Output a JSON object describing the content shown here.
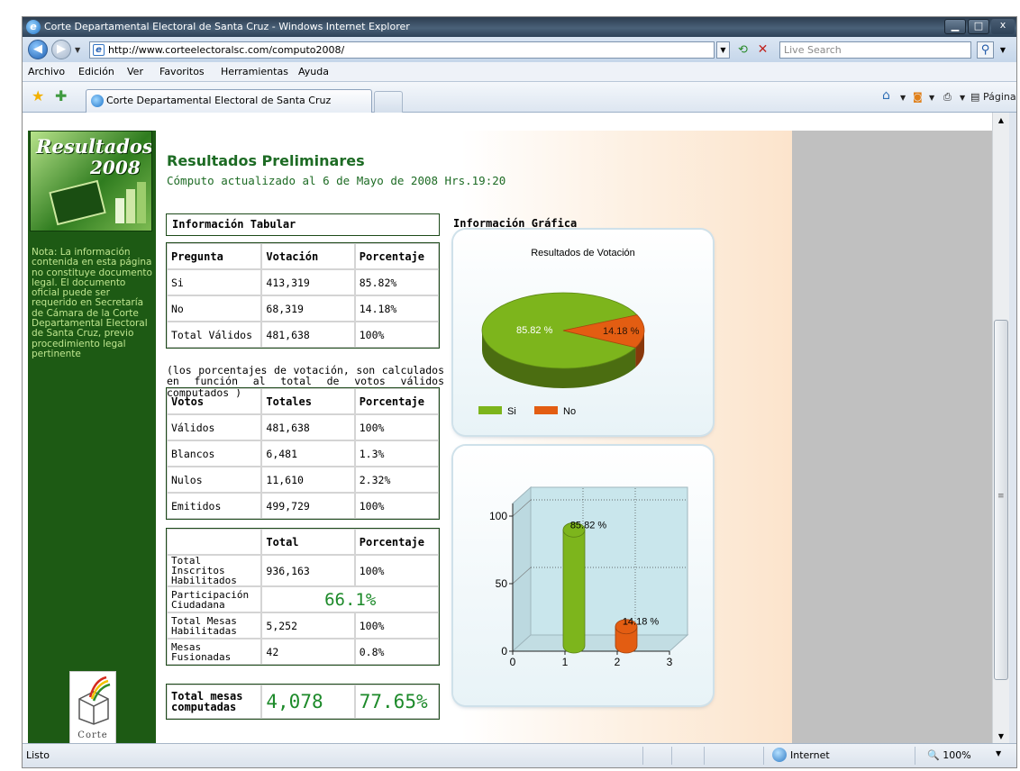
{
  "window": {
    "title": "Corte Departamental Electoral de Santa Cruz - Windows Internet Explorer",
    "close_glyph": "x"
  },
  "address": {
    "url": "http://www.corteelectoralsc.com/computo2008/",
    "search_placeholder": "Live Search"
  },
  "menu": [
    "Archivo",
    "Edición",
    "Ver",
    "Favoritos",
    "Herramientas",
    "Ayuda"
  ],
  "tab": {
    "label": "Corte Departamental Electoral de Santa Cruz"
  },
  "commands": {
    "page": "Página",
    "tools": "Herramientas"
  },
  "sidebar": {
    "logo_word": "Resultados",
    "logo_year": "2008",
    "note": "Nota: La información contenida en esta página no constituye documento legal. El documento oficial puede ser requerido en Secretaría de Cámara de la Corte Departamental Electoral de Santa Cruz, previo procedimiento legal pertinente",
    "footer_logo": "Corte"
  },
  "main": {
    "title": "Resultados Preliminares",
    "subtitle": "Cómputo actualizado al 6 de Mayo de 2008 Hrs.19:20",
    "tabular_heading": "Información Tabular",
    "graphic_heading": "Información Gráfica",
    "note": "(los porcentajes de votación, son calculados en función al total de votos válidos computados )",
    "table_votacion": {
      "headers": [
        "Pregunta",
        "Votación",
        "Porcentaje"
      ],
      "rows": [
        [
          "Si",
          "413,319",
          "85.82%"
        ],
        [
          "No",
          "68,319",
          "14.18%"
        ],
        [
          "Total Válidos",
          "481,638",
          "100%"
        ]
      ]
    },
    "table_votos": {
      "headers": [
        "Votos",
        "Totales",
        "Porcentaje"
      ],
      "rows": [
        [
          "Válidos",
          "481,638",
          "100%"
        ],
        [
          "Blancos",
          "6,481",
          "1.3%"
        ],
        [
          "Nulos",
          "11,610",
          "2.32%"
        ],
        [
          "Emitidos",
          "499,729",
          "100%"
        ]
      ]
    },
    "table_inscritos": {
      "headers": [
        "",
        "Total",
        "Porcentaje"
      ],
      "rows": [
        [
          "Total Inscritos Habilitados",
          "936,163",
          "100%"
        ],
        [
          "Participación Ciudadana",
          "66.1%"
        ],
        [
          "Total Mesas Habilitadas",
          "5,252",
          "100%"
        ],
        [
          "Mesas Fusionadas",
          "42",
          "0.8%"
        ]
      ]
    },
    "table_total": {
      "label": "Total mesas computadas",
      "value": "4,078",
      "percent": "77.65%"
    }
  },
  "chart_data": [
    {
      "type": "pie",
      "title": "Resultados de Votación",
      "categories": [
        "Si",
        "No"
      ],
      "values": [
        85.82,
        14.18
      ],
      "labels": [
        "85.82 %",
        "14.18 %"
      ],
      "colors": [
        "#7db51c",
        "#e35d12"
      ],
      "legend": "bottom-left"
    },
    {
      "type": "bar",
      "x": [
        1,
        2
      ],
      "values": [
        85.82,
        14.18
      ],
      "labels": [
        "85.82 %",
        "14.18 %"
      ],
      "colors": [
        "#7db51c",
        "#e35d12"
      ],
      "xlim": [
        0,
        3
      ],
      "ylim": [
        0,
        100
      ],
      "xticks": [
        "0",
        "1",
        "2",
        "3"
      ],
      "yticks": [
        "0",
        "50",
        "100"
      ],
      "grid": true
    }
  ],
  "status": {
    "text": "Listo",
    "zone": "Internet",
    "zoom": "100%"
  }
}
